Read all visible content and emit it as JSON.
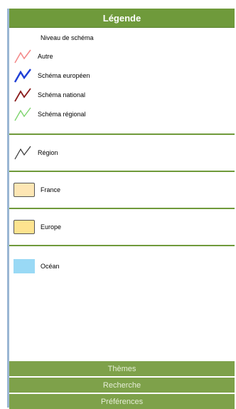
{
  "panel": {
    "title": "Légende"
  },
  "legend": {
    "schema_title": "Niveau de schéma",
    "schema_items": [
      {
        "label": "Autre",
        "icon": "zigzag-line-icon",
        "color": "#f48a8a"
      },
      {
        "label": "Schéma européen",
        "icon": "zigzag-line-icon",
        "color": "#1f3fd6"
      },
      {
        "label": "Schéma national",
        "icon": "zigzag-line-icon",
        "color": "#8a1c1c"
      },
      {
        "label": "Schéma régional",
        "icon": "zigzag-line-icon",
        "color": "#7ed46e"
      }
    ],
    "region": {
      "label": "Région",
      "icon": "zigzag-line-icon",
      "color": "#333333"
    },
    "france": {
      "label": "France",
      "fill": "#fde6b4"
    },
    "europe": {
      "label": "Europe",
      "fill": "#fde38f"
    },
    "ocean": {
      "label": "Océan",
      "fill": "#99d9f5"
    }
  },
  "tabs": {
    "themes": "Thèmes",
    "recherche": "Recherche",
    "preferences": "Préférences"
  },
  "colors": {
    "accent": "#6f9a3b",
    "tab_bg": "#7ea14a"
  }
}
